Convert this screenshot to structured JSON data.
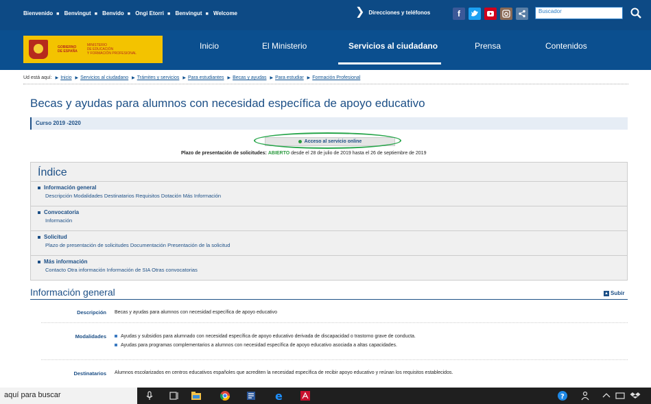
{
  "topbar": {
    "languages": [
      "Bienvenido",
      "Benvingut",
      "Benvido",
      "Ongi Etorri",
      "Benvingut",
      "Welcome"
    ],
    "directions_label": "Direcciones y teléfonos",
    "search_placeholder": "Buscador"
  },
  "logo": {
    "line1": "GOBIERNO",
    "line2": "DE ESPAÑA",
    "line3": "MINISTERIO",
    "line4": "DE EDUCACIÓN",
    "line5": "Y FORMACIÓN PROFESIONAL"
  },
  "nav": {
    "items": [
      "Inicio",
      "El Ministerio",
      "Servicios al ciudadano",
      "Prensa",
      "Contenidos"
    ]
  },
  "breadcrumb": {
    "prefix": "Ud está aquí:",
    "items": [
      "Inicio",
      "Servicios al ciudadano",
      "Trámites y servicios",
      "Para estudiantes",
      "Becas y ayudas",
      "Para estudiar",
      "Formación Profesional"
    ]
  },
  "page": {
    "title": "Becas y ayudas para alumnos con necesidad específica de apoyo educativo",
    "curso": "Curso 2019 -2020",
    "online_button": "Acceso al servicio online",
    "plazo_label": "Plazo de presentación de solicitudes:",
    "plazo_status": "ABIERTO",
    "plazo_text": "desde el 28 de julio de 2019 hasta el 26 de septiembre de 2019"
  },
  "indice": {
    "title": "Índice",
    "sections": [
      {
        "title": "Información general",
        "links": [
          "Descripción",
          "Modalidades",
          "Destinatarios",
          "Requisitos",
          "Dotación",
          "Más Información"
        ]
      },
      {
        "title": "Convocatoria",
        "links": [
          "Información"
        ]
      },
      {
        "title": "Solicitud",
        "links": [
          "Plazo de presentación de solicitudes",
          "Documentación",
          "Presentación de la solicitud"
        ]
      },
      {
        "title": "Más información",
        "links": [
          "Contacto",
          "Otra información",
          "Información de SIA",
          "Otras convocatorias"
        ]
      }
    ]
  },
  "info_general": {
    "title": "Información general",
    "subir": "Subir",
    "rows": [
      {
        "label": "Descripción",
        "value": "Becas y ayudas para alumnos con necesidad específica de apoyo educativo"
      },
      {
        "label": "Modalidades",
        "items": [
          "Ayudas y subsidios para alumnado con necesidad específica de apoyo educativo derivada de discapacidad o trastorno grave de conducta.",
          "Ayudas para programas complementarios a alumnos con necesidad específica de apoyo educativo asociada a altas capacidades."
        ]
      },
      {
        "label": "Destinatarios",
        "value": "Alumnos escolarizados en centros educativos españoles que acrediten la necesidad específica de recibir apoyo educativo y reúnan los requisitos establecidos."
      }
    ]
  },
  "taskbar": {
    "search_text": "aquí para buscar"
  },
  "colors": {
    "header_blue": "#0d4a85",
    "title_blue": "#1c4f86",
    "highlight_green": "#27a54a"
  }
}
